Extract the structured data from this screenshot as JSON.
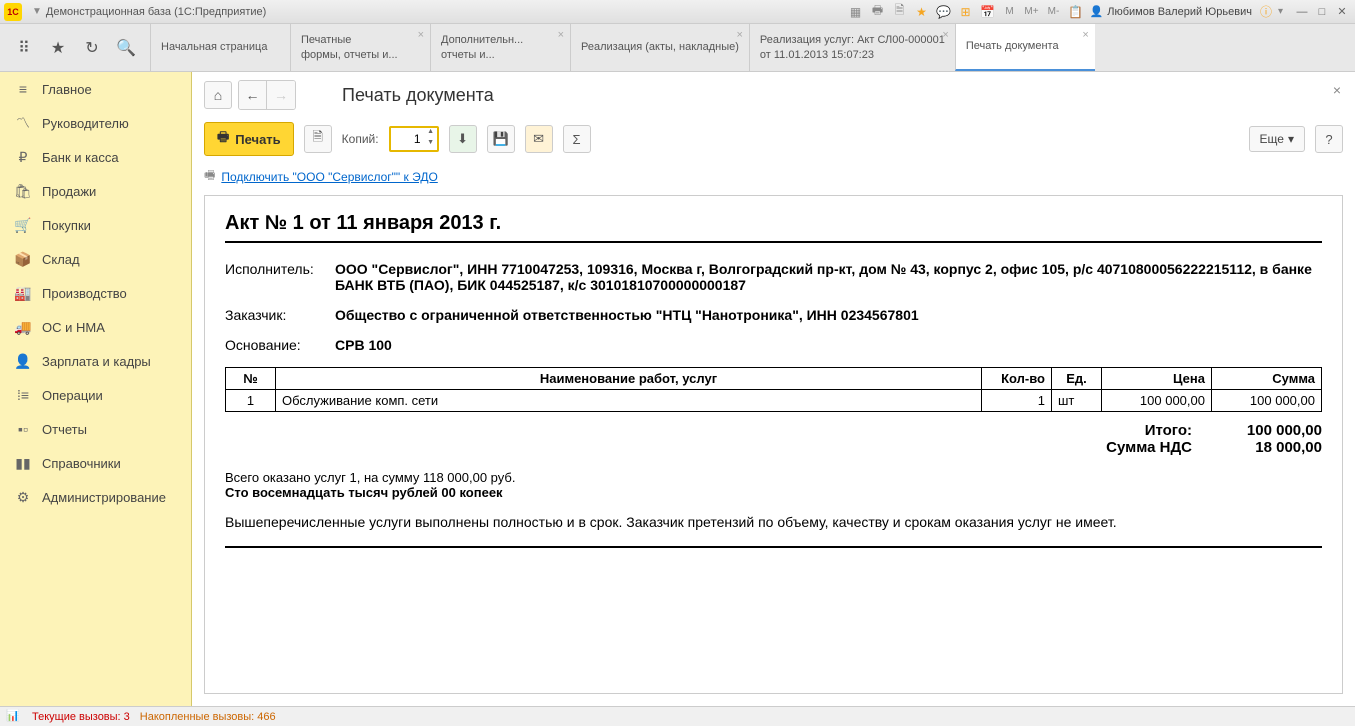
{
  "titlebar": {
    "title": "Демонстрационная база  (1С:Предприятие)",
    "user": "Любимов Валерий Юрьевич",
    "m_labels": [
      "M",
      "M+",
      "M-"
    ]
  },
  "tabs": [
    {
      "label": "Начальная страница",
      "sub": ""
    },
    {
      "label": "Печатные",
      "sub": "формы, отчеты и..."
    },
    {
      "label": "Дополнительн...",
      "sub": "отчеты и..."
    },
    {
      "label": "Реализация (акты, накладные)",
      "sub": ""
    },
    {
      "label": "Реализация услуг: Акт СЛ00-000001",
      "sub": "от 11.01.2013 15:07:23"
    },
    {
      "label": "Печать документа",
      "sub": ""
    }
  ],
  "sidebar": [
    {
      "icon": "★",
      "label": "Главное"
    },
    {
      "icon": "📈",
      "label": "Руководителю"
    },
    {
      "icon": "₽",
      "label": "Банк и касса"
    },
    {
      "icon": "🛍",
      "label": "Продажи"
    },
    {
      "icon": "🛒",
      "label": "Покупки"
    },
    {
      "icon": "📦",
      "label": "Склад"
    },
    {
      "icon": "🏭",
      "label": "Производство"
    },
    {
      "icon": "🚚",
      "label": "ОС и НМА"
    },
    {
      "icon": "👤",
      "label": "Зарплата и кадры"
    },
    {
      "icon": "≡",
      "label": "Операции"
    },
    {
      "icon": "📊",
      "label": "Отчеты"
    },
    {
      "icon": "📚",
      "label": "Справочники"
    },
    {
      "icon": "⚙",
      "label": "Администрирование"
    }
  ],
  "page": {
    "title": "Печать документа",
    "print_btn": "Печать",
    "copies_label": "Копий:",
    "copies_value": "1",
    "more_btn": "Еще",
    "edo_link": "Подключить \"ООО \"Сервислог\"\" к ЭДО"
  },
  "doc": {
    "title": "Акт № 1 от 11 января 2013 г.",
    "executor_label": "Исполнитель:",
    "executor": "ООО \"Сервислог\", ИНН 7710047253, 109316, Москва г, Волгоградский пр-кт, дом № 43, корпус 2, офис 105, р/с 40710800056222215112, в банке БАНК ВТБ (ПАО), БИК 044525187, к/с 30101810700000000187",
    "customer_label": "Заказчик:",
    "customer": "Общество с ограниченной ответственностью \"НТЦ \"Нанотроника\", ИНН 0234567801",
    "basis_label": "Основание:",
    "basis": "СРВ 100",
    "table": {
      "headers": {
        "num": "№",
        "name": "Наименование работ, услуг",
        "qty": "Кол-во",
        "unit": "Ед.",
        "price": "Цена",
        "sum": "Сумма"
      },
      "rows": [
        {
          "num": "1",
          "name": "Обслуживание комп. сети",
          "qty": "1",
          "unit": "шт",
          "price": "100 000,00",
          "sum": "100 000,00"
        }
      ]
    },
    "totals": {
      "total_label": "Итого:",
      "total": "100 000,00",
      "vat_label": "Сумма НДС",
      "vat": "18 000,00"
    },
    "summary_line": "Всего оказано услуг 1, на сумму 118 000,00 руб.",
    "summary_words": "Сто восемнадцать тысяч рублей 00 копеек",
    "conclusion": "Вышеперечисленные услуги выполнены полностью и в срок. Заказчик претензий по объему, качеству и срокам оказания услуг не имеет."
  },
  "statusbar": {
    "calls": "Текущие вызовы: 3",
    "accum": "Накопленные вызовы: 466"
  }
}
